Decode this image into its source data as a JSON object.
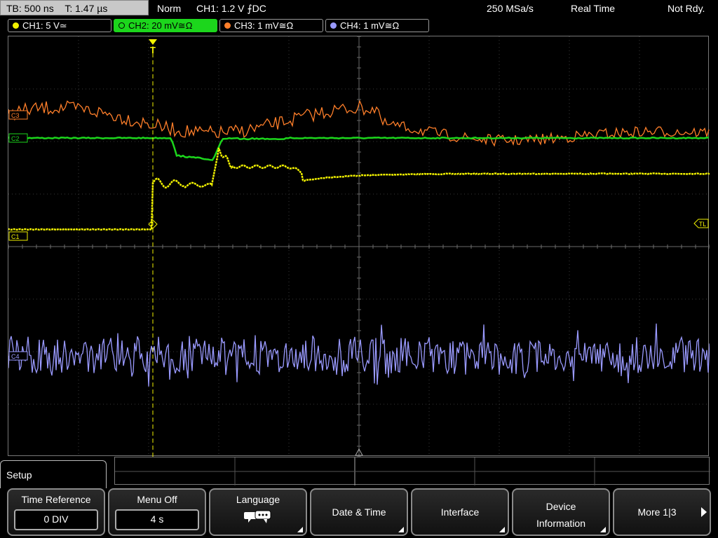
{
  "status": {
    "timebase": "TB: 500 ns",
    "trigger_time": "T: 1.47 µs",
    "mode": "Norm",
    "trigger_setting": "CH1: 1.2 V ⨍DC",
    "sample_rate": "250 MSa/s",
    "acquisition": "Real Time",
    "ready_state": "Not Rdy."
  },
  "channels": [
    {
      "label": "CH1: 5 V≃",
      "color": "#f2f200"
    },
    {
      "label": "CH2: 20 mV≅Ω",
      "color": "#1cd61c"
    },
    {
      "label": "CH3: 1 mV≅Ω",
      "color": "#ff7f2a"
    },
    {
      "label": "CH4: 1 mV≅Ω",
      "color": "#9a9aff"
    }
  ],
  "markers": {
    "trigger": "T",
    "trigger_level": "TL",
    "ch1": "C1",
    "ch2": "C2",
    "ch3": "C3",
    "ch4": "C4"
  },
  "menu": {
    "title": "Setup",
    "softkeys": [
      {
        "label": "Time Reference",
        "value": "0 DIV"
      },
      {
        "label": "Menu Off",
        "value": "4 s"
      },
      {
        "label": "Language",
        "icon": "speech-bubbles-icon"
      },
      {
        "label": "Date & Time"
      },
      {
        "label": "Interface"
      },
      {
        "label": "Device Information"
      },
      {
        "label": "More 1|3"
      }
    ]
  }
}
